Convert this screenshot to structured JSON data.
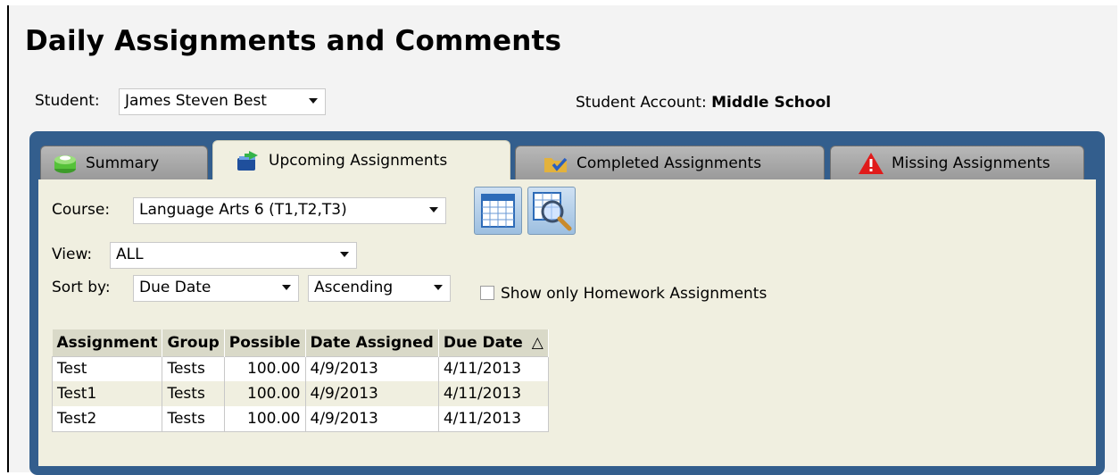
{
  "page": {
    "title": "Daily Assignments and Comments",
    "student_label": "Student:",
    "student_value": "James Steven Best",
    "account_label": "Student Account:",
    "account_value": "Middle School"
  },
  "tabs": [
    {
      "label": "Summary",
      "icon": "books-stack-icon",
      "active": false
    },
    {
      "label": "Upcoming Assignments",
      "icon": "book-arrow-icon",
      "active": true
    },
    {
      "label": "Completed Assignments",
      "icon": "folder-check-icon",
      "active": false
    },
    {
      "label": "Missing Assignments",
      "icon": "warning-icon",
      "active": false
    }
  ],
  "filters": {
    "course_label": "Course:",
    "course_value": "Language Arts 6 (T1,T2,T3)",
    "view_label": "View:",
    "view_value": "ALL",
    "sort_label": "Sort by:",
    "sort_value": "Due Date",
    "order_value": "Ascending",
    "homework_only_label": "Show only Homework Assignments",
    "homework_only_checked": false
  },
  "table": {
    "headers": [
      "Assignment",
      "Group",
      "Possible",
      "Date Assigned",
      "Due Date"
    ],
    "sort_indicator": "△",
    "rows": [
      {
        "assignment": "Test",
        "group": "Tests",
        "possible": "100.00",
        "date_assigned": "4/9/2013",
        "due_date": "4/11/2013"
      },
      {
        "assignment": "Test1",
        "group": "Tests",
        "possible": "100.00",
        "date_assigned": "4/9/2013",
        "due_date": "4/11/2013"
      },
      {
        "assignment": "Test2",
        "group": "Tests",
        "possible": "100.00",
        "date_assigned": "4/9/2013",
        "due_date": "4/11/2013"
      }
    ]
  },
  "colors": {
    "panel_border": "#335e8d",
    "panel_bg": "#f0efe0",
    "warning_red": "#e01b1b"
  }
}
